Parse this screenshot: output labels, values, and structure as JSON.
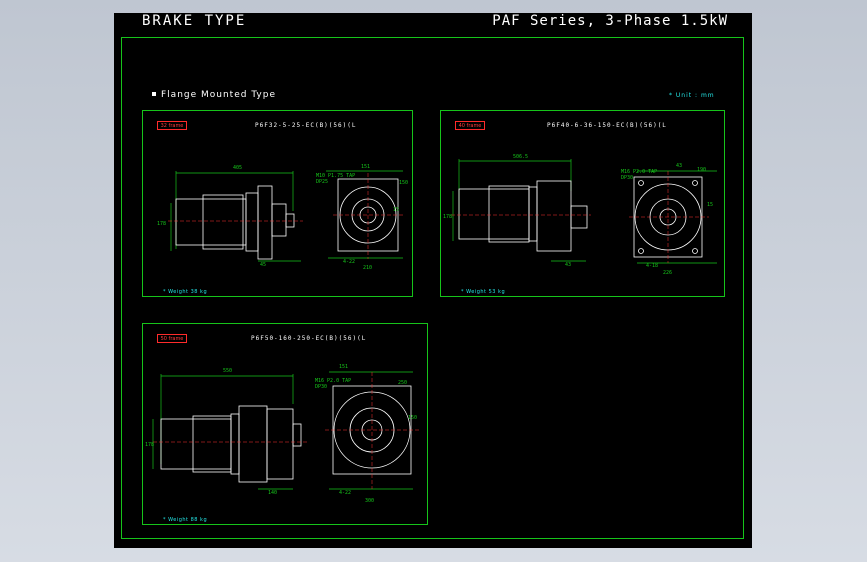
{
  "header": {
    "left_title": "BRAKE TYPE",
    "right_title": "PAF Series, 3-Phase 1.5kW"
  },
  "section": {
    "title": "Flange Mounted Type",
    "unit_note": "* Unit : mm"
  },
  "panels": [
    {
      "badge": "32 frame",
      "model": "P6F32-5-25-EC(B)(56)(L",
      "weight": "* Weight 38 kg",
      "dims": {
        "overall": "405",
        "height": "178",
        "flange": "45",
        "top": "151",
        "corner": "150",
        "side": "15",
        "bottom": "210",
        "bolt": "4-22"
      },
      "notes": [
        "M10 P1.75 TAP",
        "DP25"
      ],
      "colors": {
        "outline": "#ffffff",
        "dims": "#16c41a"
      }
    },
    {
      "badge": "40 frame",
      "model": "P6F40-6-36-150-EC(B)(56)(L",
      "weight": "* Weight 53 kg",
      "dims": {
        "overall": "506.5",
        "height": "178",
        "flange": "43",
        "top": "43",
        "corner": "190",
        "side": "15",
        "bottom": "226",
        "bolt": "4-18"
      },
      "notes": [
        "M16 P2.0 TAP",
        "DP30"
      ],
      "colors": {
        "outline": "#ffffff",
        "dims": "#16c41a"
      }
    },
    {
      "badge": "50 frame",
      "model": "P6F50-160-250-EC(B)(56)(L",
      "weight": "* Weight 88 kg",
      "dims": {
        "overall": "550",
        "height": "178",
        "flange": "140",
        "top": "151",
        "corner": "250",
        "side": "150",
        "bottom": "300",
        "bolt": "4-22"
      },
      "notes": [
        "M16 P2.0 TAP",
        "DP30"
      ],
      "colors": {
        "outline": "#ffffff",
        "dims": "#16c41a"
      }
    }
  ]
}
